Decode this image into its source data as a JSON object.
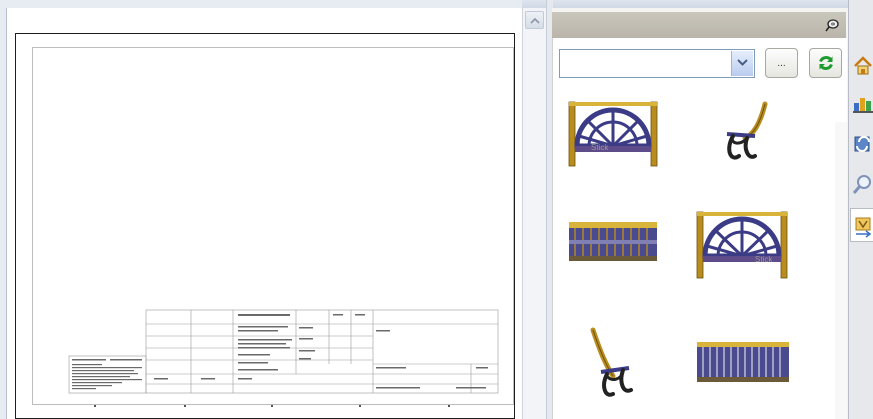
{
  "library": {
    "path_value": "",
    "browse_label": "...",
    "thumbnails": [
      {
        "name": "bench-front-view",
        "view_text": "Stick"
      },
      {
        "name": "bench-side-view",
        "view_text": ""
      },
      {
        "name": "bench-top-view",
        "view_text": ""
      },
      {
        "name": "bench-front-view-alt",
        "view_text": "Stick"
      },
      {
        "name": "bench-side-view-alt",
        "view_text": ""
      },
      {
        "name": "bench-bottom-view",
        "view_text": ""
      }
    ]
  },
  "task_pane_tabs": [
    "home-icon",
    "parts-icon",
    "library-icon",
    "search-icon",
    "view-palette-icon"
  ],
  "colors": {
    "bench_frame": "#b98c1e",
    "bench_slats": "#3b3b86",
    "panel_header": "#bfbcb2",
    "refresh_green": "#1f9a2f"
  }
}
